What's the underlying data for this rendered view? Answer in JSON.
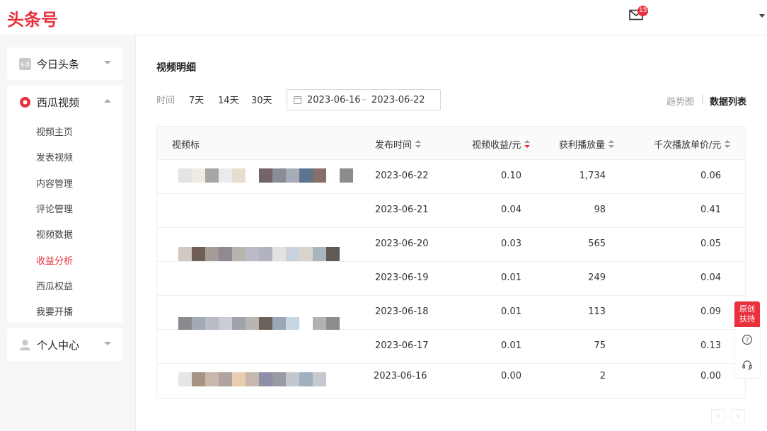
{
  "header": {
    "logo": "头条号",
    "mail_badge": "15"
  },
  "sidebar": {
    "groups": [
      {
        "label": "今日头条",
        "icon": "toutiao-icon",
        "expanded": false
      },
      {
        "label": "西瓜视频",
        "icon": "xigua-icon",
        "expanded": true,
        "items": [
          "视频主页",
          "发表视频",
          "内容管理",
          "评论管理",
          "视频数据",
          "收益分析",
          "西瓜权益",
          "我要开播"
        ],
        "active": "收益分析"
      },
      {
        "label": "个人中心",
        "icon": "user-icon",
        "expanded": false
      }
    ]
  },
  "main": {
    "title": "视频明细",
    "time_label": "时间",
    "ranges": [
      "7天",
      "14天",
      "30天"
    ],
    "date_start": "2023-06-16",
    "date_sep": "~",
    "date_end": "2023-06-22",
    "view_trend": "趋势图",
    "view_sep": "|",
    "view_list": "数据列表",
    "table": {
      "headers": [
        "视频标",
        "发布时间",
        "视频收益/元",
        "获利播放量",
        "千次播放单价/元"
      ],
      "rows": [
        {
          "date": "2023-06-22",
          "income": "0.10",
          "plays": "1,734",
          "rpm": "0.06"
        },
        {
          "date": "2023-06-21",
          "income": "0.04",
          "plays": "98",
          "rpm": "0.41"
        },
        {
          "date": "2023-06-20",
          "income": "0.03",
          "plays": "565",
          "rpm": "0.05"
        },
        {
          "date": "2023-06-19",
          "income": "0.01",
          "plays": "249",
          "rpm": "0.04"
        },
        {
          "date": "2023-06-18",
          "income": "0.01",
          "plays": "113",
          "rpm": "0.09"
        },
        {
          "date": "2023-06-17",
          "income": "0.01",
          "plays": "75",
          "rpm": "0.13"
        },
        {
          "date": "2023-06-16",
          "income": "0.00",
          "plays": "2",
          "rpm": "0.00"
        }
      ]
    },
    "pager": {
      "prev": "‹",
      "next": "›"
    }
  },
  "float": {
    "original_line1": "原创",
    "original_line2": "扶持",
    "help_icon": "question-icon",
    "service_icon": "headset-icon"
  },
  "colors": {
    "accent": "#e9313e"
  }
}
